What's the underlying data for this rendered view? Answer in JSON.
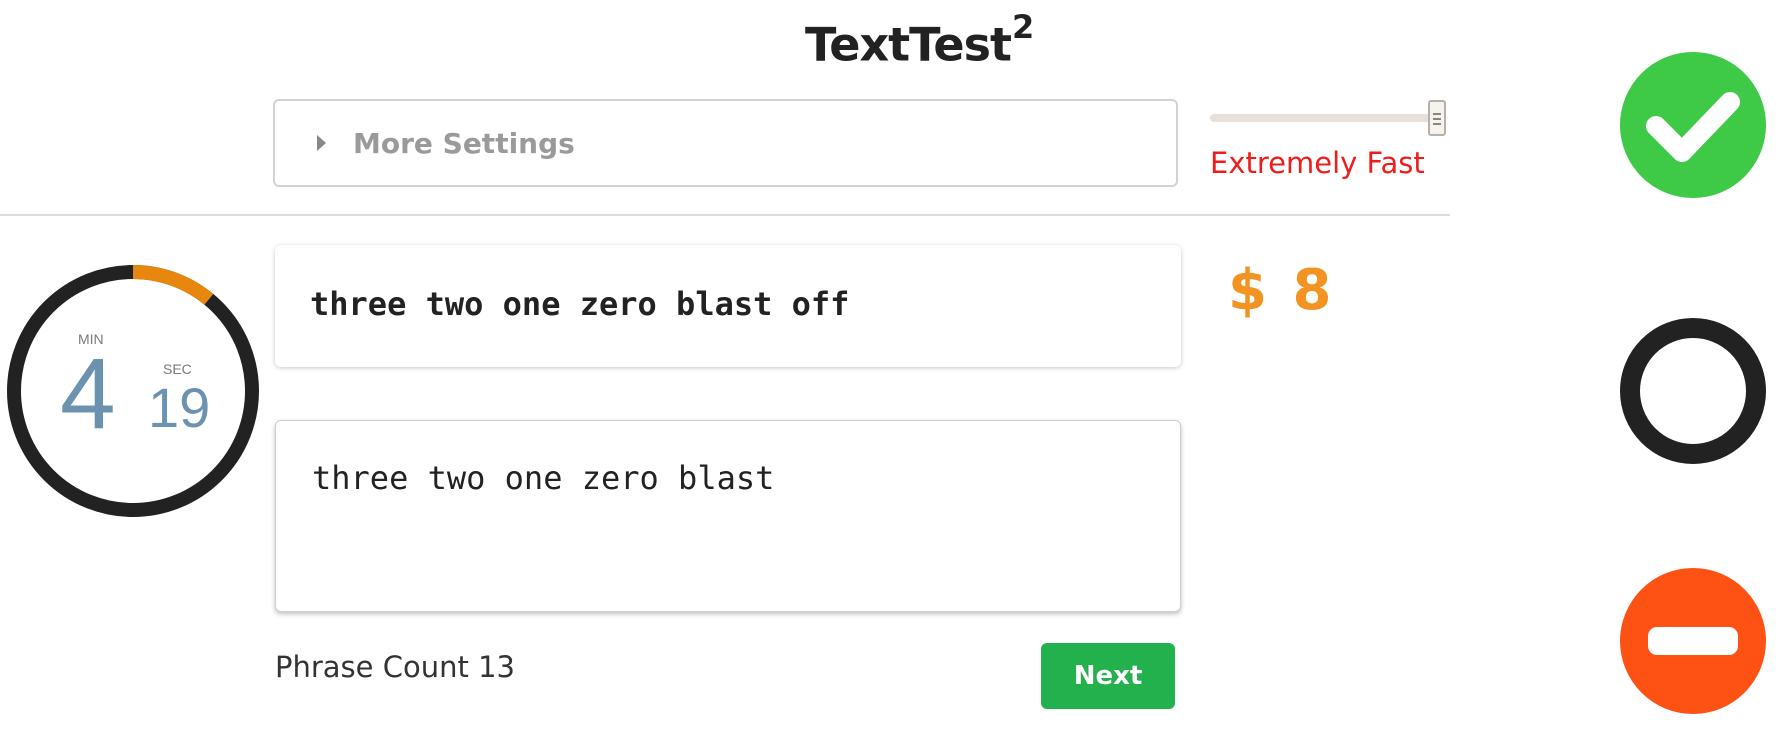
{
  "header": {
    "title": "TextTest",
    "title_superscript": "2"
  },
  "settings": {
    "label": "More Settings"
  },
  "speed": {
    "label": "Extremely Fast",
    "label_color": "#ee1c1c",
    "level": 1.0
  },
  "timer": {
    "min_label": "MIN",
    "minutes": "4",
    "sec_label": "SEC",
    "seconds": "19",
    "elapsed_fraction": 0.11,
    "ring_color": "#222222",
    "progress_color": "#e8870e"
  },
  "prompt": {
    "text": "three two one zero blast off"
  },
  "typing": {
    "value": "three two one zero blast"
  },
  "score": {
    "text": "$ 8",
    "color": "#f39321"
  },
  "footer": {
    "phrase_count": "Phrase Count 13",
    "next_label": "Next"
  },
  "status_icons": {
    "correct": {
      "icon": "check-circle-icon",
      "color": "#3ec946"
    },
    "pending": {
      "icon": "empty-circle-icon",
      "color": "#222222"
    },
    "blocked": {
      "icon": "no-entry-icon",
      "color": "#fd5214"
    }
  },
  "colors": {
    "accent_green": "#22b14c",
    "timer_digits": "#6b93b0"
  }
}
